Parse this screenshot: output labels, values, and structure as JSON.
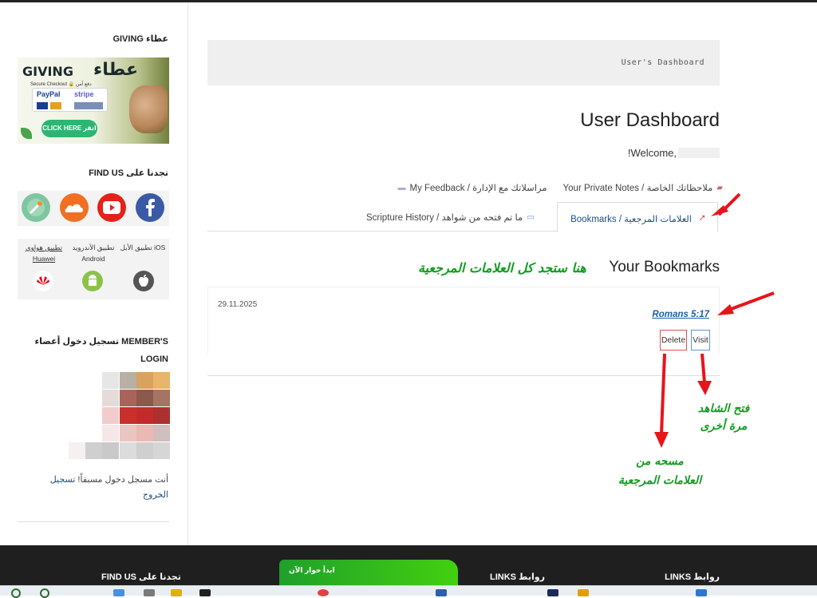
{
  "sidebar": {
    "giving_title": "عطاء GIVING",
    "giving_banner": {
      "brand_en": "GIVING",
      "brand_ar": "عطاء",
      "secure_text": "Secure Checkout 🔒 دفع آمن",
      "paypal": "PayPal",
      "stripe": "stripe",
      "cta": "CLICK HERE انقر هنا"
    },
    "findus_title": "تجدنا على FIND US",
    "apps": [
      {
        "label": "تطبيق الأبل iOS",
        "link": ""
      },
      {
        "label": "تطبيق الأندرويد Android",
        "link": ""
      },
      {
        "label": "تطبيق هواوي",
        "link": "Huawei"
      }
    ],
    "login_title": "تسجيل دخول أعضاء MEMBER'S LOGIN",
    "logged_in_text": "أنت مسجل دخول مسبقاً!",
    "logout_link": "تسجيل الخروج"
  },
  "main": {
    "breadcrumb": "User's Dashboard",
    "page_title": "User Dashboard",
    "welcome": "!Welcome,",
    "tabs_row1": [
      {
        "label": "Your Private Notes / ملاحظاتك الخاصة",
        "icon": "notes-icon"
      },
      {
        "label": "My Feedback / مراسلاتك مع الإدارة",
        "icon": "feedback-icon"
      }
    ],
    "tabs_row2": [
      {
        "label": "Bookmarks / العلامات المرجعية",
        "icon": "bookmark-icon",
        "active": true
      },
      {
        "label": "Scripture History / ما تم فتحه من شواهد",
        "icon": "book-icon",
        "active": false
      }
    ],
    "bookmarks_heading": "Your Bookmarks",
    "bookmarks_annotation": "هنا ستجد كل العلامات المرجعية",
    "bookmark": {
      "date": "29.11.2025",
      "reference": "Romans 5:17",
      "delete_label": "Delete",
      "visit_label": "Visit"
    },
    "annotation_visit": [
      "فتح الشاهد",
      "مرة أخرى"
    ],
    "annotation_delete": [
      "مسحه من",
      "العلامات المرجعية"
    ]
  },
  "footer": {
    "col1": "روابط LINKS",
    "col2": "روابط LINKS",
    "col3": "تجدنا على FIND US",
    "chat_label": "ابدأ حوار الآن"
  },
  "colors": {
    "annotation_green": "#0f9d1f",
    "annotation_red": "#e8141b",
    "link_blue": "#1a5ea8",
    "footer_bg": "#1f1f1f"
  }
}
